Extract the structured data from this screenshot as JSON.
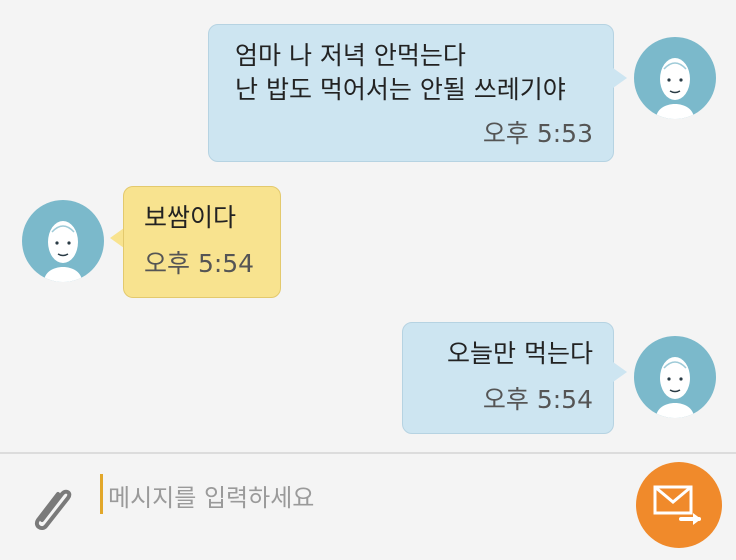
{
  "messages": [
    {
      "text": "엄마 나 저녁 안먹는다\n난 밥도 먹어서는 안될 쓰레기야",
      "time": "오후 5:53",
      "side": "right",
      "color": "#cde5f1"
    },
    {
      "text": "보쌈이다",
      "time": "오후 5:54",
      "side": "left",
      "color": "#f8e38f"
    },
    {
      "text": "오늘만 먹는다",
      "time": "오후 5:54",
      "side": "right",
      "color": "#cde5f1"
    }
  ],
  "input": {
    "placeholder": "메시지를 입력하세요"
  },
  "icons": {
    "attach": "paperclip-icon",
    "send": "envelope-send-icon",
    "avatar": "person-avatar-icon"
  },
  "colors": {
    "accent": "#f08a2b",
    "avatar_bg": "#7bb9cb"
  }
}
